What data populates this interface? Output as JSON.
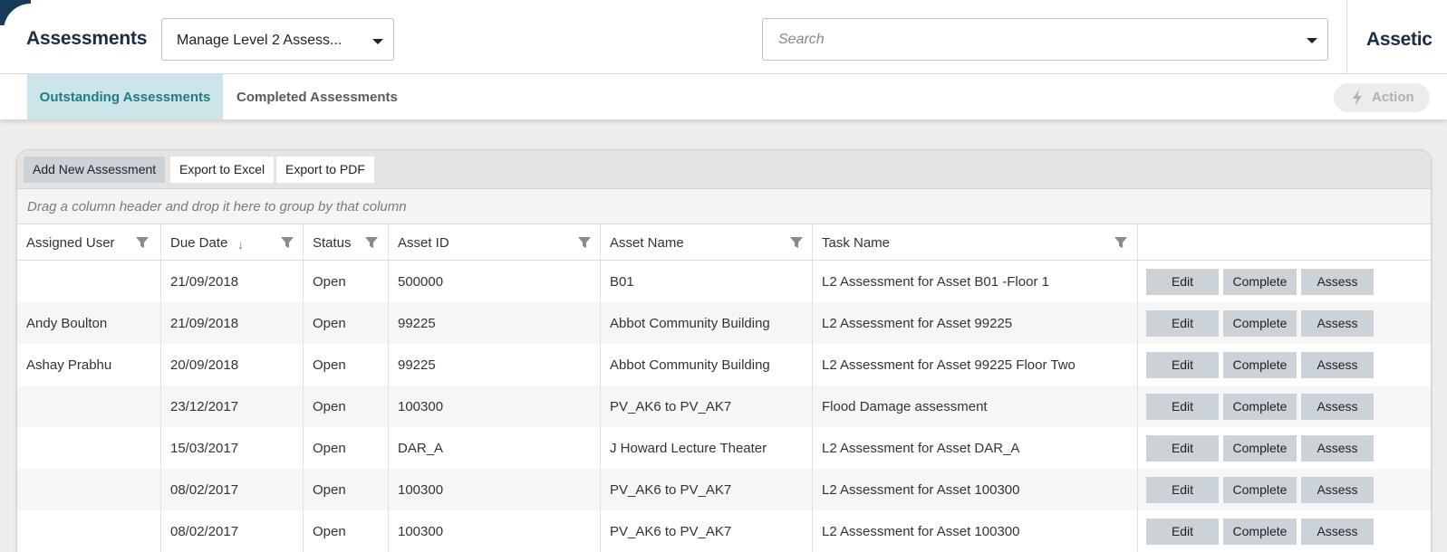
{
  "header": {
    "title": "Assessments",
    "level_select": "Manage Level 2 Assess...",
    "search_placeholder": "Search",
    "brand": "Assetic"
  },
  "tabs": [
    {
      "label": "Outstanding Assessments",
      "active": true
    },
    {
      "label": "Completed Assessments",
      "active": false
    }
  ],
  "action_label": "Action",
  "toolbar": {
    "add": "Add New Assessment",
    "excel": "Export to Excel",
    "pdf": "Export to PDF"
  },
  "grouping_hint": "Drag a column header and drop it here to group by that column",
  "columns": [
    "Assigned User",
    "Due Date",
    "Status",
    "Asset ID",
    "Asset Name",
    "Task Name"
  ],
  "row_buttons": {
    "edit": "Edit",
    "complete": "Complete",
    "assess": "Assess"
  },
  "rows": [
    {
      "user": "",
      "due": "21/09/2018",
      "status": "Open",
      "asset_id": "500000",
      "asset_name": "B01",
      "task": "L2 Assessment for Asset B01 -Floor 1"
    },
    {
      "user": "Andy Boulton",
      "due": "21/09/2018",
      "status": "Open",
      "asset_id": "99225",
      "asset_name": "Abbot Community Building",
      "task": "L2 Assessment for Asset 99225"
    },
    {
      "user": "Ashay Prabhu",
      "due": "20/09/2018",
      "status": "Open",
      "asset_id": "99225",
      "asset_name": "Abbot Community Building",
      "task": "L2 Assessment for Asset 99225 Floor Two"
    },
    {
      "user": "",
      "due": "23/12/2017",
      "status": "Open",
      "asset_id": "100300",
      "asset_name": "PV_AK6 to PV_AK7",
      "task": "Flood Damage assessment"
    },
    {
      "user": "",
      "due": "15/03/2017",
      "status": "Open",
      "asset_id": "DAR_A",
      "asset_name": "J Howard Lecture Theater",
      "task": "L2 Assessment for Asset DAR_A"
    },
    {
      "user": "",
      "due": "08/02/2017",
      "status": "Open",
      "asset_id": "100300",
      "asset_name": "PV_AK6 to PV_AK7",
      "task": "L2 Assessment for Asset 100300"
    },
    {
      "user": "",
      "due": "08/02/2017",
      "status": "Open",
      "asset_id": "100300",
      "asset_name": "PV_AK6 to PV_AK7",
      "task": "L2 Assessment for Asset 100300"
    }
  ]
}
